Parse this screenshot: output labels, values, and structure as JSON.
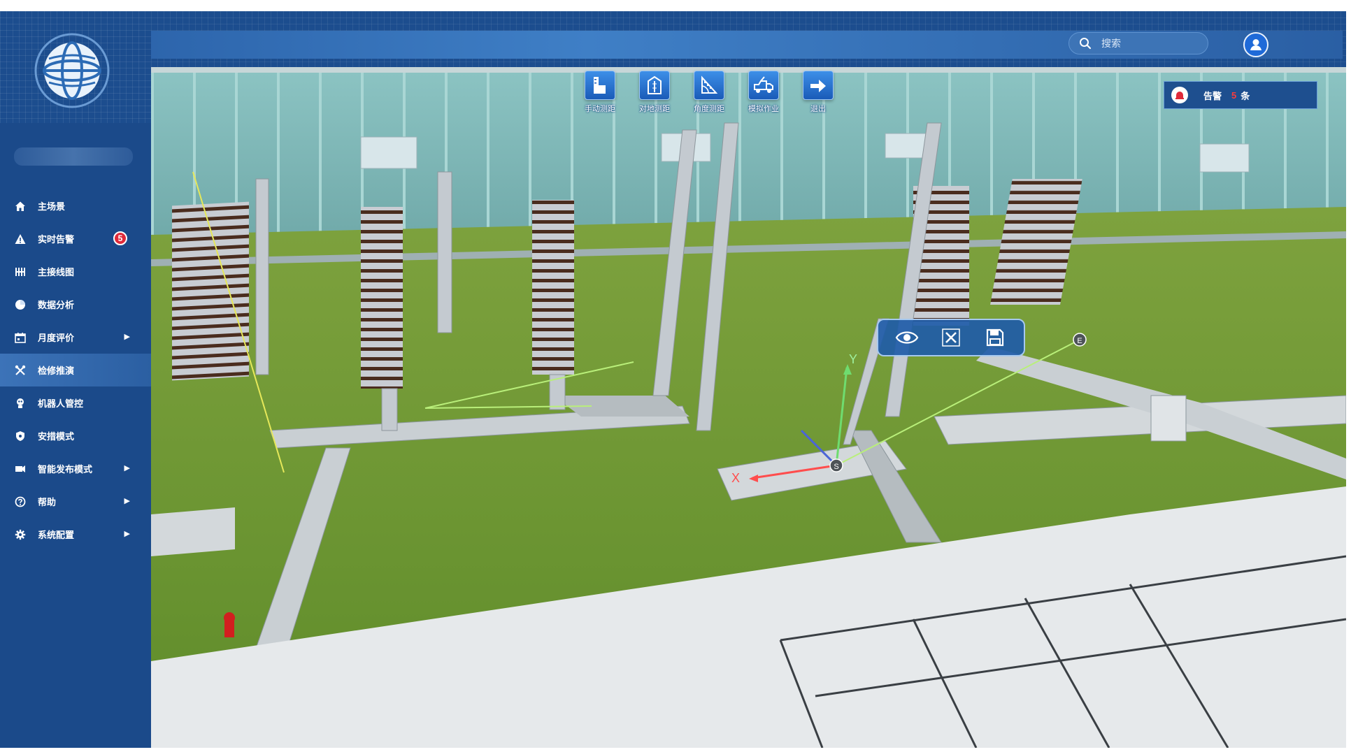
{
  "header": {
    "search_placeholder": "搜索"
  },
  "sidebar": {
    "items": [
      {
        "label": "主场景",
        "icon": "home-icon",
        "active": false,
        "chevron": false
      },
      {
        "label": "实时告警",
        "icon": "warning-icon",
        "active": false,
        "chevron": false,
        "badge": "5"
      },
      {
        "label": "主接线图",
        "icon": "wiring-icon",
        "active": false,
        "chevron": false
      },
      {
        "label": "数据分析",
        "icon": "pie-chart-icon",
        "active": false,
        "chevron": false
      },
      {
        "label": "月度评价",
        "icon": "calendar-icon",
        "active": false,
        "chevron": true
      },
      {
        "label": "检修推演",
        "icon": "tools-icon",
        "active": true,
        "chevron": false
      },
      {
        "label": "机器人管控",
        "icon": "robot-icon",
        "active": false,
        "chevron": false
      },
      {
        "label": "安措模式",
        "icon": "shield-icon",
        "active": false,
        "chevron": false
      },
      {
        "label": "智能发布模式",
        "icon": "broadcast-icon",
        "active": false,
        "chevron": true
      },
      {
        "label": "帮助",
        "icon": "help-icon",
        "active": false,
        "chevron": true
      },
      {
        "label": "系统配置",
        "icon": "gear-icon",
        "active": false,
        "chevron": true
      }
    ]
  },
  "toolbar": {
    "items": [
      {
        "label": "手动测距",
        "icon": "manual-measure-icon"
      },
      {
        "label": "对地测距",
        "icon": "ground-measure-icon"
      },
      {
        "label": "角度测距",
        "icon": "angle-measure-icon"
      },
      {
        "label": "模拟作业",
        "icon": "simulation-truck-icon"
      },
      {
        "label": "退出",
        "icon": "exit-icon"
      }
    ]
  },
  "alarm": {
    "label": "告警",
    "count": "5",
    "unit": "条"
  },
  "scene": {
    "start_marker": "S",
    "end_marker": "E",
    "axis_x": "X",
    "axis_y": "Y"
  },
  "measure_popup": {
    "buttons": [
      "view-icon",
      "close-icon",
      "save-icon"
    ]
  },
  "colors": {
    "sidebar": "#1b4a8a",
    "active_item": "#3c73b8",
    "accent": "#2f7ee0",
    "badge": "#e02a3a",
    "grass": "#6f9a33",
    "wall": "#7fb6b4",
    "measure_line": "#b9ef7a"
  }
}
